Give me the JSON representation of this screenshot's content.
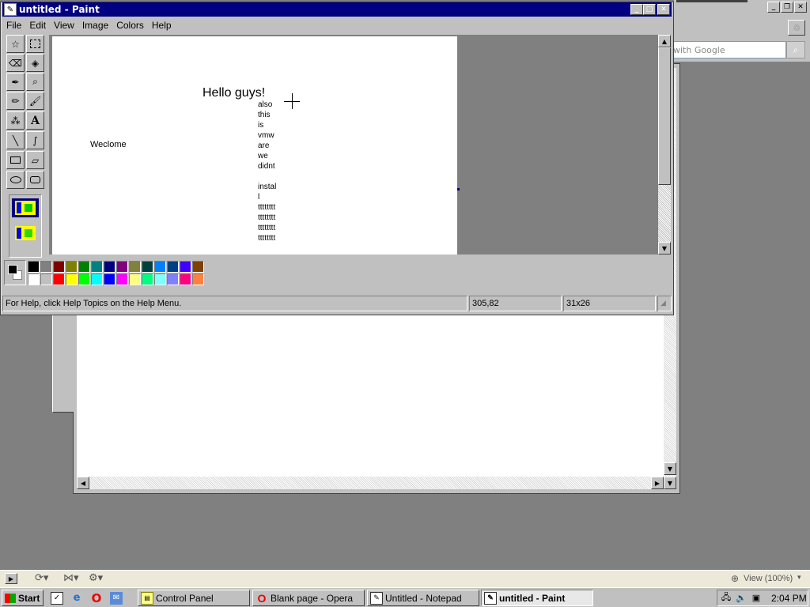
{
  "paint": {
    "title": "untitled - Paint",
    "menus": [
      "File",
      "Edit",
      "View",
      "Image",
      "Colors",
      "Help"
    ],
    "canvas_text": {
      "heading": "Hello guys!",
      "welcome": "Weclome",
      "lines": [
        "also",
        "this",
        "is",
        "vmw",
        "are",
        "we",
        "didnt",
        "",
        "instal",
        "l",
        "tttttttt",
        "tttttttt",
        "tttttttt",
        "tttttttt"
      ]
    },
    "palette_top": [
      "#000000",
      "#808080",
      "#800000",
      "#808000",
      "#008000",
      "#008080",
      "#000080",
      "#800080",
      "#808040",
      "#004040",
      "#0080ff",
      "#004080",
      "#4000ff",
      "#804000"
    ],
    "palette_bottom": [
      "#ffffff",
      "#c0c0c0",
      "#ff0000",
      "#ffff00",
      "#00ff00",
      "#00ffff",
      "#0000ff",
      "#ff00ff",
      "#ffff80",
      "#00ff80",
      "#80ffff",
      "#8080ff",
      "#ff0080",
      "#ff8040"
    ],
    "foreground_color": "#000000",
    "background_color": "#ffffff",
    "status": {
      "help": "For Help, click Help Topics on the Help Menu.",
      "coords": "305,82",
      "size": "31x26"
    }
  },
  "browser": {
    "search_placeholder": "with Google"
  },
  "quickbar": {
    "zoom": "View (100%)"
  },
  "taskbar": {
    "start": "Start",
    "tasks": [
      "Control Panel",
      "Blank page - Opera",
      "Untitled - Notepad",
      "untitled - Paint"
    ],
    "clock": "2:04 PM"
  }
}
